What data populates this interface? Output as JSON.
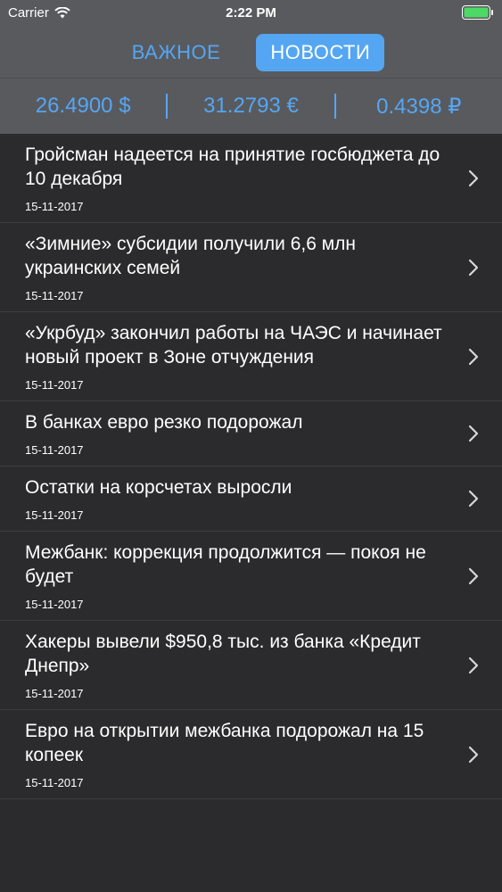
{
  "status_bar": {
    "carrier": "Carrier",
    "time": "2:22 PM",
    "battery_color": "#4cd964"
  },
  "tabs": [
    {
      "label": "ВАЖНОЕ",
      "active": false
    },
    {
      "label": "НОВОСТИ",
      "active": true
    }
  ],
  "rates": {
    "usd": "26.4900 $",
    "eur": "31.2793 €",
    "rub": "0.4398 ₽"
  },
  "news": [
    {
      "title": "Гройсман надеется на принятие госбюджета до 10 декабря",
      "date": "15-11-2017"
    },
    {
      "title": "«Зимние» субсидии получили 6,6 млн украинских семей",
      "date": "15-11-2017"
    },
    {
      "title": "«Укрбуд» закончил работы на ЧАЭС и начинает новый проект в Зоне отчуждения",
      "date": "15-11-2017"
    },
    {
      "title": "В банках евро резко подорожал",
      "date": "15-11-2017"
    },
    {
      "title": "Остатки на корсчетах выросли",
      "date": "15-11-2017"
    },
    {
      "title": "Межбанк: коррекция продолжится — покоя не будет",
      "date": "15-11-2017"
    },
    {
      "title": "Хакеры вывели $950,8 тыс. из банка «Кредит Днепр»",
      "date": "15-11-2017"
    },
    {
      "title": "Евро на открытии межбанка подорожал на 15 копеек",
      "date": "15-11-2017"
    }
  ],
  "colors": {
    "accent": "#55a6f2",
    "header_bg": "#595a5e",
    "list_bg": "#2b2b2d"
  }
}
